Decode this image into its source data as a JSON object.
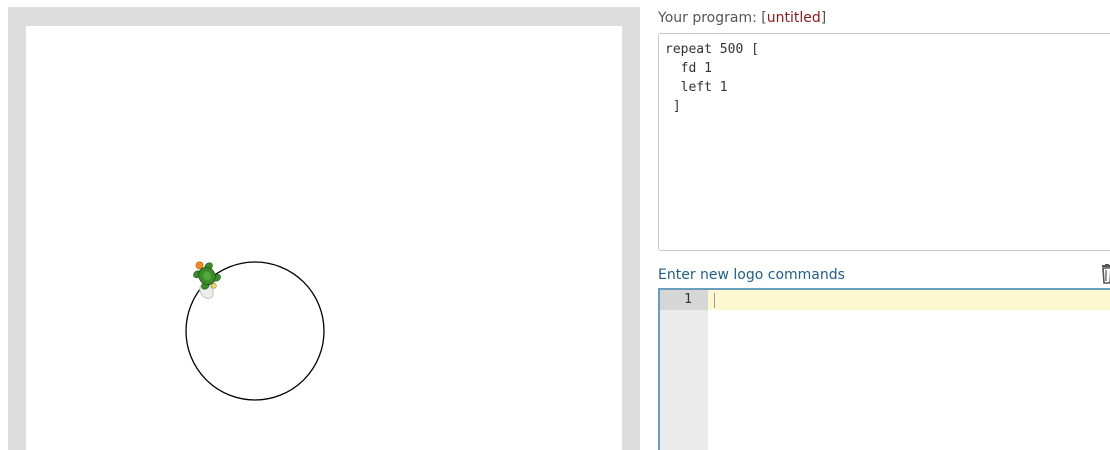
{
  "program": {
    "label": "Your program: [",
    "name": "untitled",
    "label_end": "]",
    "code": "repeat 500 [\n  fd 1\n  left 1\n ]"
  },
  "editor": {
    "label": "Enter new logo commands",
    "line_numbers": [
      "1"
    ],
    "trash_icon": "trash-icon",
    "active_line_color": "#fdf8cf"
  },
  "canvas": {
    "turtle_icon": "turtle-icon",
    "turtle_color": "#3a8c2a",
    "turtle_head_color": "#f08c1e",
    "path_color": "#000000"
  }
}
